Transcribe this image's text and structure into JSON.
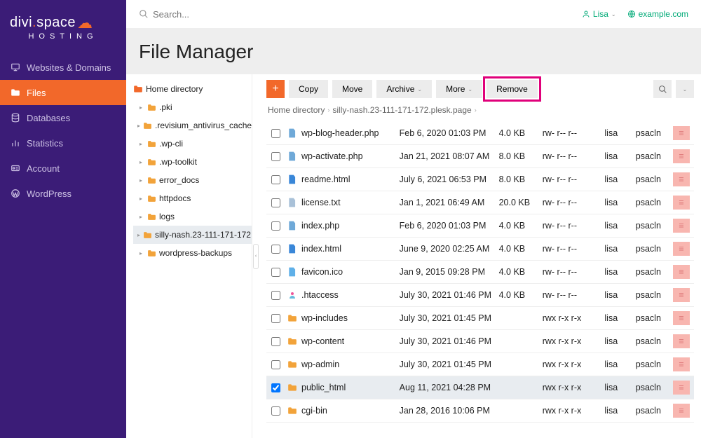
{
  "logo": {
    "brand_a": "divi",
    "brand_b": "space",
    "sub": "HOSTING"
  },
  "sidebar": {
    "items": [
      {
        "label": "Websites & Domains",
        "icon": "monitor"
      },
      {
        "label": "Files",
        "icon": "folder"
      },
      {
        "label": "Databases",
        "icon": "database"
      },
      {
        "label": "Statistics",
        "icon": "stats"
      },
      {
        "label": "Account",
        "icon": "account"
      },
      {
        "label": "WordPress",
        "icon": "wordpress"
      }
    ]
  },
  "topbar": {
    "search_placeholder": "Search...",
    "user": "Lisa",
    "domain": "example.com"
  },
  "page_title": "File Manager",
  "tree": {
    "root_label": "Home directory",
    "items": [
      ".pki",
      ".revisium_antivirus_cache",
      ".wp-cli",
      ".wp-toolkit",
      "error_docs",
      "httpdocs",
      "logs",
      "silly-nash.23-111-171-172",
      "wordpress-backups"
    ],
    "selected_index": 7
  },
  "toolbar": {
    "copy": "Copy",
    "move": "Move",
    "archive": "Archive",
    "more": "More",
    "remove": "Remove"
  },
  "breadcrumb": [
    "Home directory",
    "silly-nash.23-111-171-172.plesk.page"
  ],
  "files": [
    {
      "name": "wp-blog-header.php",
      "type": "php",
      "date": "Feb 6, 2020 01:03 PM",
      "size": "4.0 KB",
      "perm": "rw- r-- r--",
      "user": "lisa",
      "group": "psacln",
      "checked": false
    },
    {
      "name": "wp-activate.php",
      "type": "php",
      "date": "Jan 21, 2021 08:07 AM",
      "size": "8.0 KB",
      "perm": "rw- r-- r--",
      "user": "lisa",
      "group": "psacln",
      "checked": false
    },
    {
      "name": "readme.html",
      "type": "html",
      "date": "July 6, 2021 06:53 PM",
      "size": "8.0 KB",
      "perm": "rw- r-- r--",
      "user": "lisa",
      "group": "psacln",
      "checked": false
    },
    {
      "name": "license.txt",
      "type": "txt",
      "date": "Jan 1, 2021 06:49 AM",
      "size": "20.0 KB",
      "perm": "rw- r-- r--",
      "user": "lisa",
      "group": "psacln",
      "checked": false
    },
    {
      "name": "index.php",
      "type": "php",
      "date": "Feb 6, 2020 01:03 PM",
      "size": "4.0 KB",
      "perm": "rw- r-- r--",
      "user": "lisa",
      "group": "psacln",
      "checked": false
    },
    {
      "name": "index.html",
      "type": "html",
      "date": "June 9, 2020 02:25 AM",
      "size": "4.0 KB",
      "perm": "rw- r-- r--",
      "user": "lisa",
      "group": "psacln",
      "checked": false
    },
    {
      "name": "favicon.ico",
      "type": "ico",
      "date": "Jan 9, 2015 09:28 PM",
      "size": "4.0 KB",
      "perm": "rw- r-- r--",
      "user": "lisa",
      "group": "psacln",
      "checked": false
    },
    {
      "name": ".htaccess",
      "type": "dot",
      "date": "July 30, 2021 01:46 PM",
      "size": "4.0 KB",
      "perm": "rw- r-- r--",
      "user": "lisa",
      "group": "psacln",
      "checked": false
    },
    {
      "name": "wp-includes",
      "type": "folder",
      "date": "July 30, 2021 01:45 PM",
      "size": "",
      "perm": "rwx r-x r-x",
      "user": "lisa",
      "group": "psacln",
      "checked": false
    },
    {
      "name": "wp-content",
      "type": "folder",
      "date": "July 30, 2021 01:46 PM",
      "size": "",
      "perm": "rwx r-x r-x",
      "user": "lisa",
      "group": "psacln",
      "checked": false
    },
    {
      "name": "wp-admin",
      "type": "folder",
      "date": "July 30, 2021 01:45 PM",
      "size": "",
      "perm": "rwx r-x r-x",
      "user": "lisa",
      "group": "psacln",
      "checked": false
    },
    {
      "name": "public_html",
      "type": "folder",
      "date": "Aug 11, 2021 04:28 PM",
      "size": "",
      "perm": "rwx r-x r-x",
      "user": "lisa",
      "group": "psacln",
      "checked": true
    },
    {
      "name": "cgi-bin",
      "type": "folder",
      "date": "Jan 28, 2016 10:06 PM",
      "size": "",
      "perm": "rwx r-x r-x",
      "user": "lisa",
      "group": "psacln",
      "checked": false
    }
  ]
}
